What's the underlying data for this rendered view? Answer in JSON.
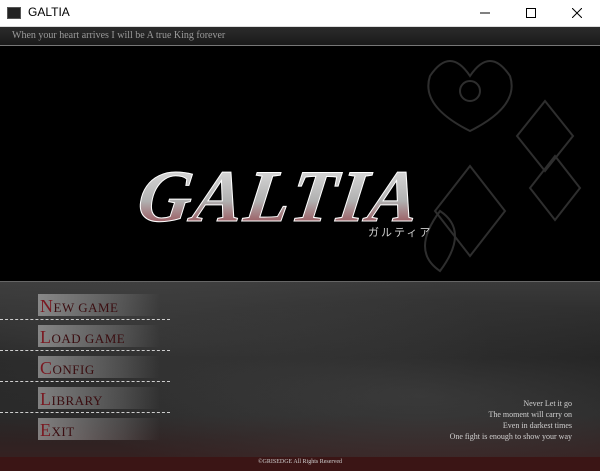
{
  "window": {
    "title": "GALTIA"
  },
  "game": {
    "tagline": "When your heart arrives I will be A true King forever",
    "logo_text": "GALTIA",
    "logo_subtitle": "ガルティア",
    "menu": [
      {
        "cap": "N",
        "rest": "EW GAME"
      },
      {
        "cap": "L",
        "rest": "OAD GAME"
      },
      {
        "cap": "C",
        "rest": "ONFIG"
      },
      {
        "cap": "L",
        "rest": "IBRARY"
      },
      {
        "cap": "E",
        "rest": "XIT"
      }
    ],
    "poem": [
      "Never Let it go",
      "The moment will carry on",
      "Even in darkest times",
      "One fight is enough to show your way"
    ],
    "copyright": "©GRISEDGE All Rights Reserved"
  },
  "colors": {
    "accent": "#7a1820",
    "logo_red": "#8c1f2a"
  }
}
